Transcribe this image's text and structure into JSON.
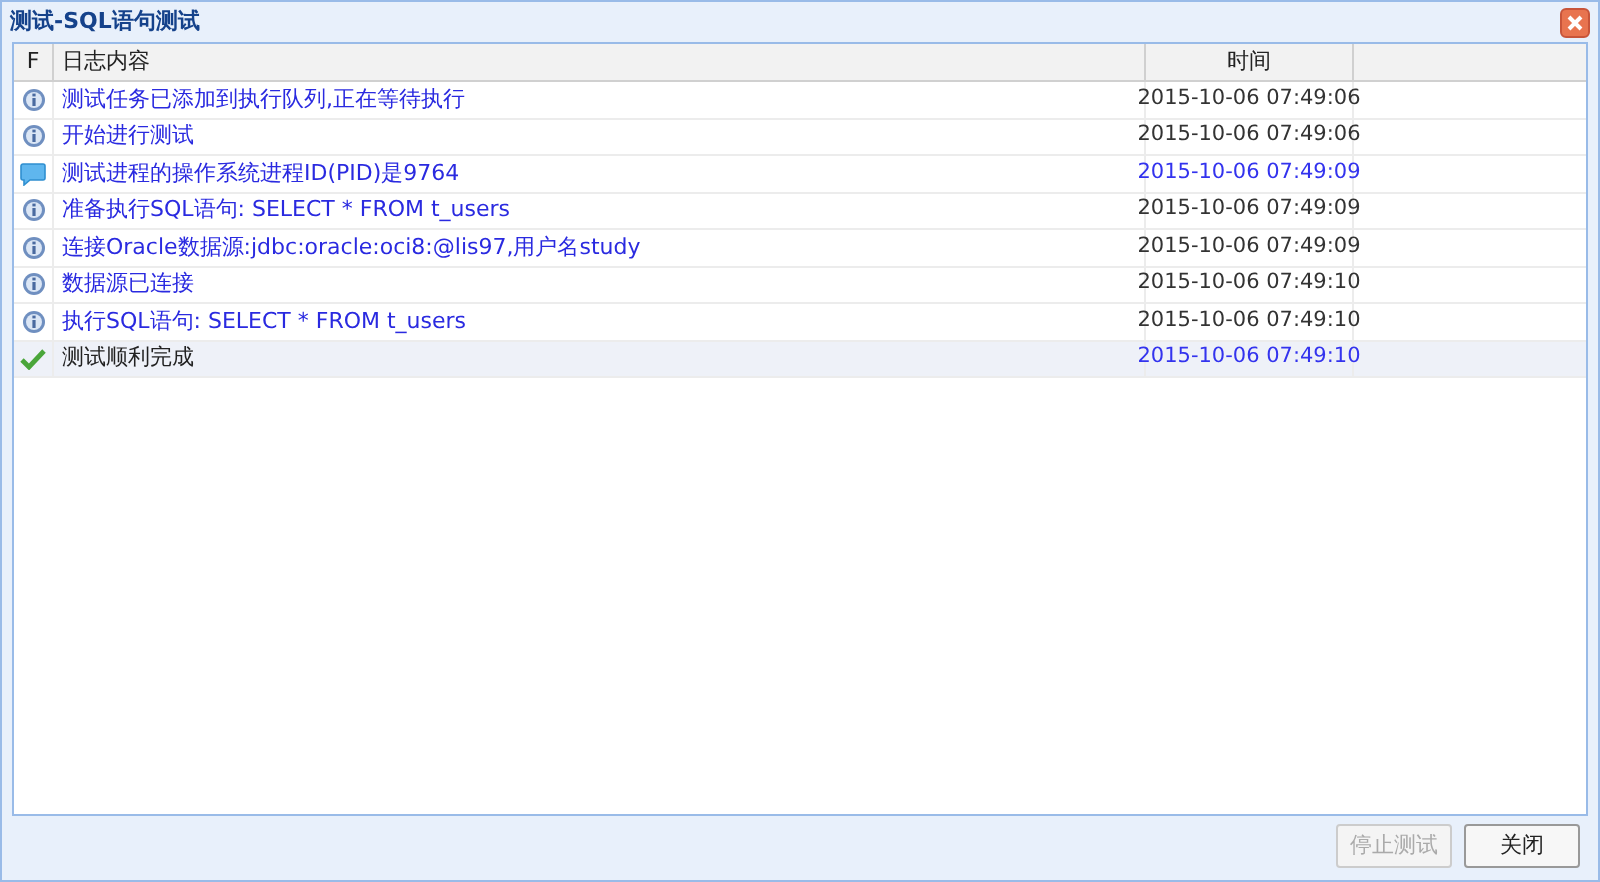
{
  "window": {
    "title": "测试-SQL语句测试"
  },
  "table": {
    "columns": [
      "F",
      "日志内容",
      "时间"
    ],
    "rows": [
      {
        "kind": "info",
        "message": "测试任务已添加到执行队列,正在等待执行",
        "time": "2015-10-06 07:49:06",
        "time_highlighted": false,
        "selected": false
      },
      {
        "kind": "info",
        "message": "开始进行测试",
        "time": "2015-10-06 07:49:06",
        "time_highlighted": false,
        "selected": false
      },
      {
        "kind": "message",
        "message": "测试进程的操作系统进程ID(PID)是9764",
        "time": "2015-10-06 07:49:09",
        "time_highlighted": true,
        "selected": false
      },
      {
        "kind": "info",
        "message": "准备执行SQL语句: SELECT * FROM t_users",
        "time": "2015-10-06 07:49:09",
        "time_highlighted": false,
        "selected": false
      },
      {
        "kind": "info",
        "message": "连接Oracle数据源:jdbc:oracle:oci8:@lis97,用户名study",
        "time": "2015-10-06 07:49:09",
        "time_highlighted": false,
        "selected": false
      },
      {
        "kind": "info",
        "message": "数据源已连接",
        "time": "2015-10-06 07:49:10",
        "time_highlighted": false,
        "selected": false
      },
      {
        "kind": "info",
        "message": "执行SQL语句: SELECT * FROM t_users",
        "time": "2015-10-06 07:49:10",
        "time_highlighted": false,
        "selected": false
      },
      {
        "kind": "success",
        "message": "测试顺利完成",
        "time": "2015-10-06 07:49:10",
        "time_highlighted": true,
        "selected": true
      }
    ]
  },
  "buttons": [
    {
      "label": "停止测试",
      "disabled": true
    },
    {
      "label": "关闭",
      "disabled": false
    }
  ]
}
